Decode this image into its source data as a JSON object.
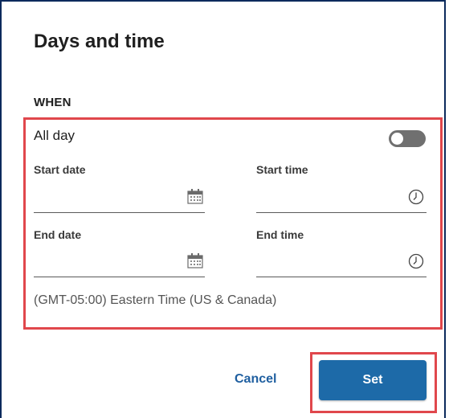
{
  "dialog": {
    "title": "Days and time",
    "section_label": "WHEN",
    "all_day": {
      "label": "All day",
      "state": "off"
    },
    "start_date": {
      "label": "Start date",
      "value": ""
    },
    "start_time": {
      "label": "Start time",
      "value": ""
    },
    "end_date": {
      "label": "End date",
      "value": ""
    },
    "end_time": {
      "label": "End time",
      "value": ""
    },
    "timezone": "(GMT-05:00) Eastern Time (US & Canada)",
    "cancel_label": "Cancel",
    "set_label": "Set"
  },
  "colors": {
    "accent": "#1d6aa8",
    "highlight": "#e0474c",
    "toggle_off": "#707070"
  }
}
